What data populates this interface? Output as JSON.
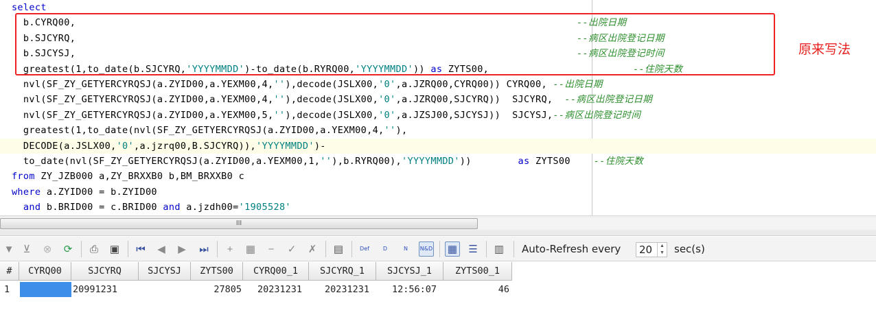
{
  "editor": {
    "lines": [
      [
        {
          "t": "kw",
          "v": "  select"
        }
      ],
      [
        {
          "t": "pl",
          "v": "    b.CYRQ00,"
        }
      ],
      [
        {
          "t": "pl",
          "v": "    b.SJCYRQ,"
        }
      ],
      [
        {
          "t": "pl",
          "v": "    b.SJCYSJ,"
        }
      ],
      [
        {
          "t": "pl",
          "v": "    greatest(1,to_date(b.SJCYRQ,"
        },
        {
          "t": "str",
          "v": "'YYYYMMDD'"
        },
        {
          "t": "pl",
          "v": ")-to_date(b.RYRQ00,"
        },
        {
          "t": "str",
          "v": "'YYYYMMDD'"
        },
        {
          "t": "pl",
          "v": ")) "
        },
        {
          "t": "kw",
          "v": "as"
        },
        {
          "t": "pl",
          "v": " ZYTS00,"
        }
      ],
      [
        {
          "t": "pl",
          "v": "    nvl(SF_ZY_GETYERCYRQSJ(a.ZYID00,a.YEXM00,4,"
        },
        {
          "t": "str",
          "v": "''"
        },
        {
          "t": "pl",
          "v": "),decode(JSLX00,"
        },
        {
          "t": "str",
          "v": "'0'"
        },
        {
          "t": "pl",
          "v": ",a.JZRQ00,CYRQ00)) CYRQ00, "
        },
        {
          "t": "cm",
          "v": "--出院日期"
        }
      ],
      [
        {
          "t": "pl",
          "v": "    nvl(SF_ZY_GETYERCYRQSJ(a.ZYID00,a.YEXM00,4,"
        },
        {
          "t": "str",
          "v": "''"
        },
        {
          "t": "pl",
          "v": "),decode(JSLX00,"
        },
        {
          "t": "str",
          "v": "'0'"
        },
        {
          "t": "pl",
          "v": ",a.JZRQ00,SJCYRQ))  SJCYRQ,  "
        },
        {
          "t": "cm",
          "v": "--病区出院登记日期"
        }
      ],
      [
        {
          "t": "pl",
          "v": "    nvl(SF_ZY_GETYERCYRQSJ(a.ZYID00,a.YEXM00,5,"
        },
        {
          "t": "str",
          "v": "''"
        },
        {
          "t": "pl",
          "v": "),decode(JSLX00,"
        },
        {
          "t": "str",
          "v": "'0'"
        },
        {
          "t": "pl",
          "v": ",a.JZSJ00,SJCYSJ))  SJCYSJ,"
        },
        {
          "t": "cm",
          "v": "--病区出院登记时间"
        }
      ],
      [
        {
          "t": "pl",
          "v": "    greatest(1,to_date(nvl(SF_ZY_GETYERCYRQSJ(a.ZYID00,a.YEXM00,4,"
        },
        {
          "t": "str",
          "v": "''"
        },
        {
          "t": "pl",
          "v": "),"
        }
      ],
      [
        {
          "t": "pl",
          "v": "    DECODE(a.JSLX00,"
        },
        {
          "t": "str",
          "v": "'0'"
        },
        {
          "t": "pl",
          "v": ",a.jzrq00,B.SJCYRQ)),"
        },
        {
          "t": "str",
          "v": "'YYYYMMDD'"
        },
        {
          "t": "pl",
          "v": ")-"
        }
      ],
      [
        {
          "t": "pl",
          "v": "    to_date(nvl(SF_ZY_GETYERCYRQSJ(a.ZYID00,a.YEXM00,1,"
        },
        {
          "t": "str",
          "v": "''"
        },
        {
          "t": "pl",
          "v": "),b.RYRQ00),"
        },
        {
          "t": "str",
          "v": "'YYYYMMDD'"
        },
        {
          "t": "pl",
          "v": "))        "
        },
        {
          "t": "kw",
          "v": "as"
        },
        {
          "t": "pl",
          "v": " ZYTS00    "
        },
        {
          "t": "cm",
          "v": "--住院天数"
        }
      ],
      [
        {
          "t": "kw",
          "v": "  from"
        },
        {
          "t": "pl",
          "v": " ZY_JZB000 a,ZY_BRXXB0 b,BM_BRXXB0 c"
        }
      ],
      [
        {
          "t": "kw",
          "v": "  where"
        },
        {
          "t": "pl",
          "v": " a.ZYID00 = b.ZYID00"
        }
      ],
      [
        {
          "t": "pl",
          "v": "    "
        },
        {
          "t": "kw",
          "v": "and"
        },
        {
          "t": "pl",
          "v": " b.BRID00 = c.BRID00 "
        },
        {
          "t": "kw",
          "v": "and"
        },
        {
          "t": "pl",
          "v": " a.jzdh00="
        },
        {
          "t": "str",
          "v": "'1905528'"
        }
      ]
    ],
    "comments_right": [
      {
        "line": 1,
        "text": "--出院日期"
      },
      {
        "line": 2,
        "text": "--病区出院登记日期"
      },
      {
        "line": 3,
        "text": "--病区出院登记时间"
      },
      {
        "line": 4,
        "text": "--住院天数"
      }
    ],
    "annotation": "原来写法",
    "scrollbar_grip": "III"
  },
  "toolbar": {
    "auto_refresh_label": "Auto-Refresh every",
    "interval_value": "20",
    "unit_label": "sec(s)",
    "def_label": "Def",
    "d_label": "D",
    "n_label": "N",
    "nd_label": "N&D"
  },
  "grid": {
    "columns": [
      "#",
      "CYRQ00",
      "SJCYRQ",
      "SJCYSJ",
      "ZYTS00",
      "CYRQ00_1",
      "SJCYRQ_1",
      "SJCYSJ_1",
      "ZYTS00_1"
    ],
    "rows": [
      [
        "1",
        "",
        "20991231",
        "",
        "27805",
        "20231231",
        "20231231",
        "12:56:07",
        "46"
      ]
    ]
  },
  "colors": {
    "keyword": "#0000cc",
    "string": "#008080",
    "comment": "#2f8f2f",
    "annotation": "#e82020",
    "selection": "#3d8ee8"
  }
}
